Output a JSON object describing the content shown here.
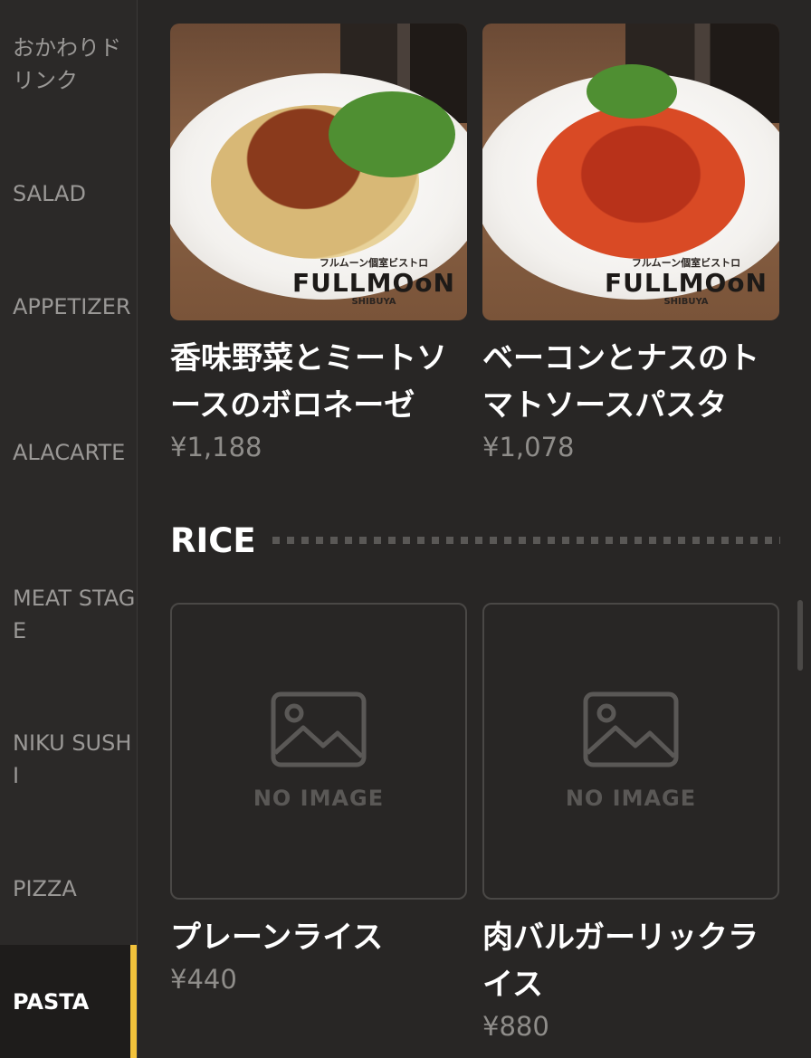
{
  "sidebar": {
    "items": [
      {
        "label": "おかわりドリンク"
      },
      {
        "label": "SALAD"
      },
      {
        "label": "APPETIZER"
      },
      {
        "label": "ALACARTE"
      },
      {
        "label": "MEAT STAGE"
      },
      {
        "label": "NIKU SUSHI"
      },
      {
        "label": "PIZZA"
      },
      {
        "label": "PASTA",
        "active": true
      }
    ],
    "accent_color": "#f2c23b"
  },
  "pasta_items": [
    {
      "name": "香味野菜とミートソースのボロネーゼ",
      "price": "¥1,188",
      "image": "bolognese-photo",
      "logo": {
        "top": "フルムーン個室ビストロ",
        "main": "FULLMOoN",
        "sub": "SHIBUYA"
      }
    },
    {
      "name": "ベーコンとナスのトマトソースパスタ",
      "price": "¥1,078",
      "image": "tomato-pasta-photo",
      "logo": {
        "top": "フルムーン個室ビストロ",
        "main": "FULLMOoN",
        "sub": "SHIBUYA"
      }
    }
  ],
  "rice_section": {
    "title": "RICE",
    "items": [
      {
        "name": "プレーンライス",
        "price": "¥440",
        "placeholder": "NO IMAGE"
      },
      {
        "name": "肉バルガーリックライス",
        "price": "¥880",
        "placeholder": "NO IMAGE"
      }
    ]
  }
}
